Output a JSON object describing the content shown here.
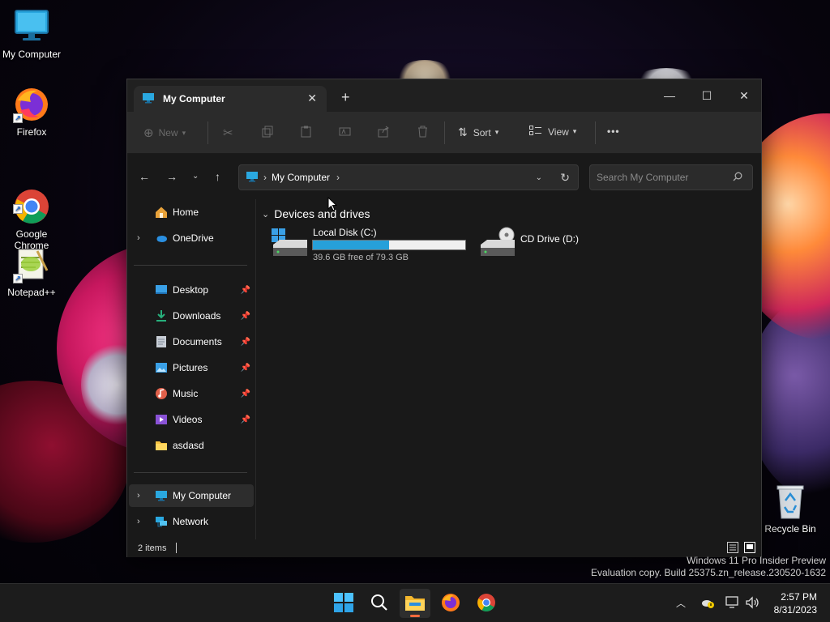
{
  "desktop": {
    "icons": [
      {
        "label": "My Computer",
        "icon": "monitor-icon"
      },
      {
        "label": "Firefox",
        "icon": "firefox-icon"
      },
      {
        "label": "Google\nChrome",
        "icon": "chrome-icon"
      },
      {
        "label": "Notepad++",
        "icon": "notepadpp-icon"
      },
      {
        "label": "Recycle Bin",
        "icon": "recycle-bin-icon"
      }
    ]
  },
  "window": {
    "tab_title": "My Computer",
    "new_tab": "+",
    "controls": {
      "minimize": "—",
      "maximize": "☐",
      "close": "✕"
    },
    "toolbar": {
      "new_label": "New",
      "sort_label": "Sort",
      "view_label": "View",
      "more_label": "•••"
    },
    "address": {
      "crumb": "My Computer",
      "search_placeholder": "Search My Computer"
    },
    "nav": {
      "home": "Home",
      "onedrive": "OneDrive",
      "desktop": "Desktop",
      "downloads": "Downloads",
      "documents": "Documents",
      "pictures": "Pictures",
      "music": "Music",
      "videos": "Videos",
      "asdasd": "asdasd",
      "my_computer": "My Computer",
      "network": "Network"
    },
    "content": {
      "group_header": "Devices and drives",
      "drives": [
        {
          "name": "Local Disk (C:)",
          "free_text": "39.6 GB free of 79.3 GB",
          "used_fraction": 0.5
        },
        {
          "name": "CD Drive (D:)"
        }
      ]
    },
    "status": {
      "count": "2 items"
    }
  },
  "watermark": {
    "line1": "Windows 11 Pro Insider Preview",
    "line2": "Evaluation copy. Build 25375.zn_release.230520-1632"
  },
  "taskbar": {
    "time": "2:57 PM",
    "date": "8/31/2023"
  },
  "colors": {
    "accent": "#26a0da",
    "window_bg": "#191919",
    "toolbar_bg": "#2b2b2b",
    "taskbar_bg": "#1c1c1c"
  }
}
